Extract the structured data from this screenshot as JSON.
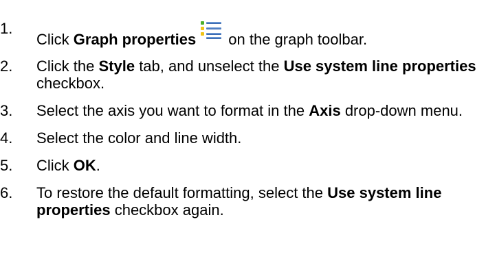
{
  "steps": [
    {
      "number": "1.",
      "before": "Click ",
      "strong": "Graph properties",
      "icon": "graph-properties-icon",
      "after": "on the graph toolbar."
    },
    {
      "number": "2.",
      "before": "Click the ",
      "strong1": "Style",
      "middle": " tab, and unselect the ",
      "strong2": "Use system line properties",
      "after": " checkbox."
    },
    {
      "number": "3.",
      "before": "Select the axis you want to format in the ",
      "strong": "Axis",
      "after": " drop-down menu."
    },
    {
      "number": "4.",
      "text": "Select the color and line width."
    },
    {
      "number": "5.",
      "before": "Click ",
      "strong": "OK",
      "after": "."
    },
    {
      "number": "6.",
      "before": "To restore the default formatting, select the ",
      "strong": "Use system line properties",
      "after": " checkbox again."
    }
  ],
  "colors": {
    "text": "#000000",
    "icon_bullet_green": "#4caf2a",
    "icon_bullet_yellow": "#f0c419",
    "icon_line_blue": "#3d6fb6"
  }
}
